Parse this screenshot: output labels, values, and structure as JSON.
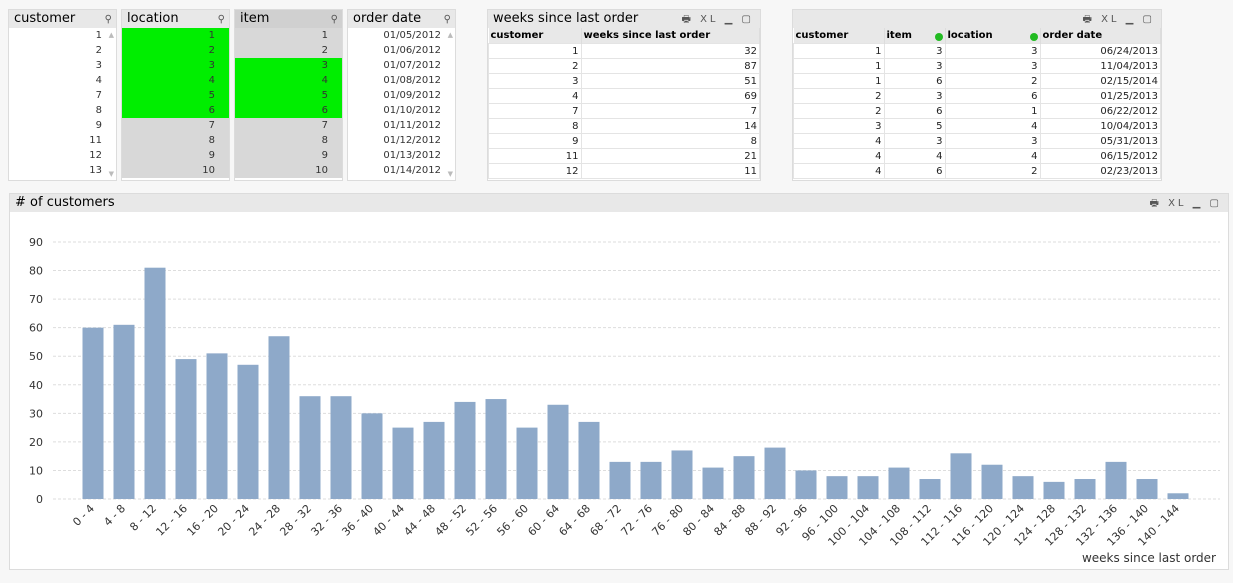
{
  "listboxes": [
    {
      "title": "customer",
      "values": [
        "1",
        "2",
        "3",
        "4",
        "7",
        "8",
        "9",
        "11",
        "12",
        "13"
      ],
      "states": [
        "n",
        "n",
        "n",
        "n",
        "n",
        "n",
        "n",
        "n",
        "n",
        "n"
      ]
    },
    {
      "title": "location",
      "values": [
        "1",
        "2",
        "3",
        "4",
        "5",
        "6",
        "7",
        "8",
        "9",
        "10"
      ],
      "states": [
        "s",
        "s",
        "s",
        "s",
        "s",
        "s",
        "a",
        "a",
        "a",
        "a"
      ]
    },
    {
      "title": "item",
      "values": [
        "1",
        "2",
        "3",
        "4",
        "5",
        "6",
        "7",
        "8",
        "9",
        "10"
      ],
      "states": [
        "a",
        "a",
        "s",
        "s",
        "s",
        "s",
        "a",
        "a",
        "a",
        "a"
      ]
    },
    {
      "title": "order date",
      "values": [
        "01/05/2012",
        "01/06/2012",
        "01/07/2012",
        "01/08/2012",
        "01/09/2012",
        "01/10/2012",
        "01/11/2012",
        "01/12/2012",
        "01/13/2012",
        "01/14/2012"
      ],
      "states": [
        "n",
        "n",
        "n",
        "n",
        "n",
        "n",
        "n",
        "n",
        "n",
        "n"
      ]
    }
  ],
  "table1": {
    "title": "weeks since last order",
    "headers": [
      "customer",
      "weeks since last order"
    ],
    "rows": [
      [
        "1",
        "32"
      ],
      [
        "2",
        "87"
      ],
      [
        "3",
        "51"
      ],
      [
        "4",
        "69"
      ],
      [
        "7",
        "7"
      ],
      [
        "8",
        "14"
      ],
      [
        "9",
        "8"
      ],
      [
        "11",
        "21"
      ],
      [
        "12",
        "11"
      ]
    ]
  },
  "table2": {
    "headers": [
      "customer",
      "item",
      "location",
      "order date"
    ],
    "rows": [
      [
        "1",
        "3",
        "3",
        "06/24/2013"
      ],
      [
        "1",
        "3",
        "3",
        "11/04/2013"
      ],
      [
        "1",
        "6",
        "2",
        "02/15/2014"
      ],
      [
        "2",
        "3",
        "6",
        "01/25/2013"
      ],
      [
        "2",
        "6",
        "1",
        "06/22/2012"
      ],
      [
        "3",
        "5",
        "4",
        "10/04/2013"
      ],
      [
        "4",
        "3",
        "3",
        "05/31/2013"
      ],
      [
        "4",
        "4",
        "4",
        "06/15/2012"
      ],
      [
        "4",
        "6",
        "2",
        "02/23/2013"
      ]
    ]
  },
  "colors": {
    "selected": "#00ee00",
    "bar": "#8ea9c9",
    "alternative": "#d8d8d8"
  },
  "chart_data": {
    "type": "bar",
    "title": "# of customers",
    "xlabel": "weeks since last order",
    "ylabel": "",
    "ylim": [
      0,
      90
    ],
    "yticks": [
      0,
      10,
      20,
      30,
      40,
      50,
      60,
      70,
      80,
      90
    ],
    "grid": true,
    "categories": [
      "0 - 4",
      "4 - 8",
      "8 - 12",
      "12 - 16",
      "16 - 20",
      "20 - 24",
      "24 - 28",
      "28 - 32",
      "32 - 36",
      "36 - 40",
      "40 - 44",
      "44 - 48",
      "48 - 52",
      "52 - 56",
      "56 - 60",
      "60 - 64",
      "64 - 68",
      "68 - 72",
      "72 - 76",
      "76 - 80",
      "80 - 84",
      "84 - 88",
      "88 - 92",
      "92 - 96",
      "96 - 100",
      "100 - 104",
      "104 - 108",
      "108 - 112",
      "112 - 116",
      "116 - 120",
      "120 - 124",
      "124 - 128",
      "128 - 132",
      "132 - 136",
      "136 - 140",
      "140 - 144"
    ],
    "values": [
      60,
      61,
      81,
      49,
      51,
      47,
      57,
      36,
      36,
      30,
      25,
      27,
      34,
      35,
      25,
      33,
      27,
      13,
      13,
      17,
      11,
      15,
      18,
      10,
      8,
      8,
      11,
      7,
      16,
      12,
      8,
      6,
      7,
      13,
      7,
      2
    ]
  }
}
